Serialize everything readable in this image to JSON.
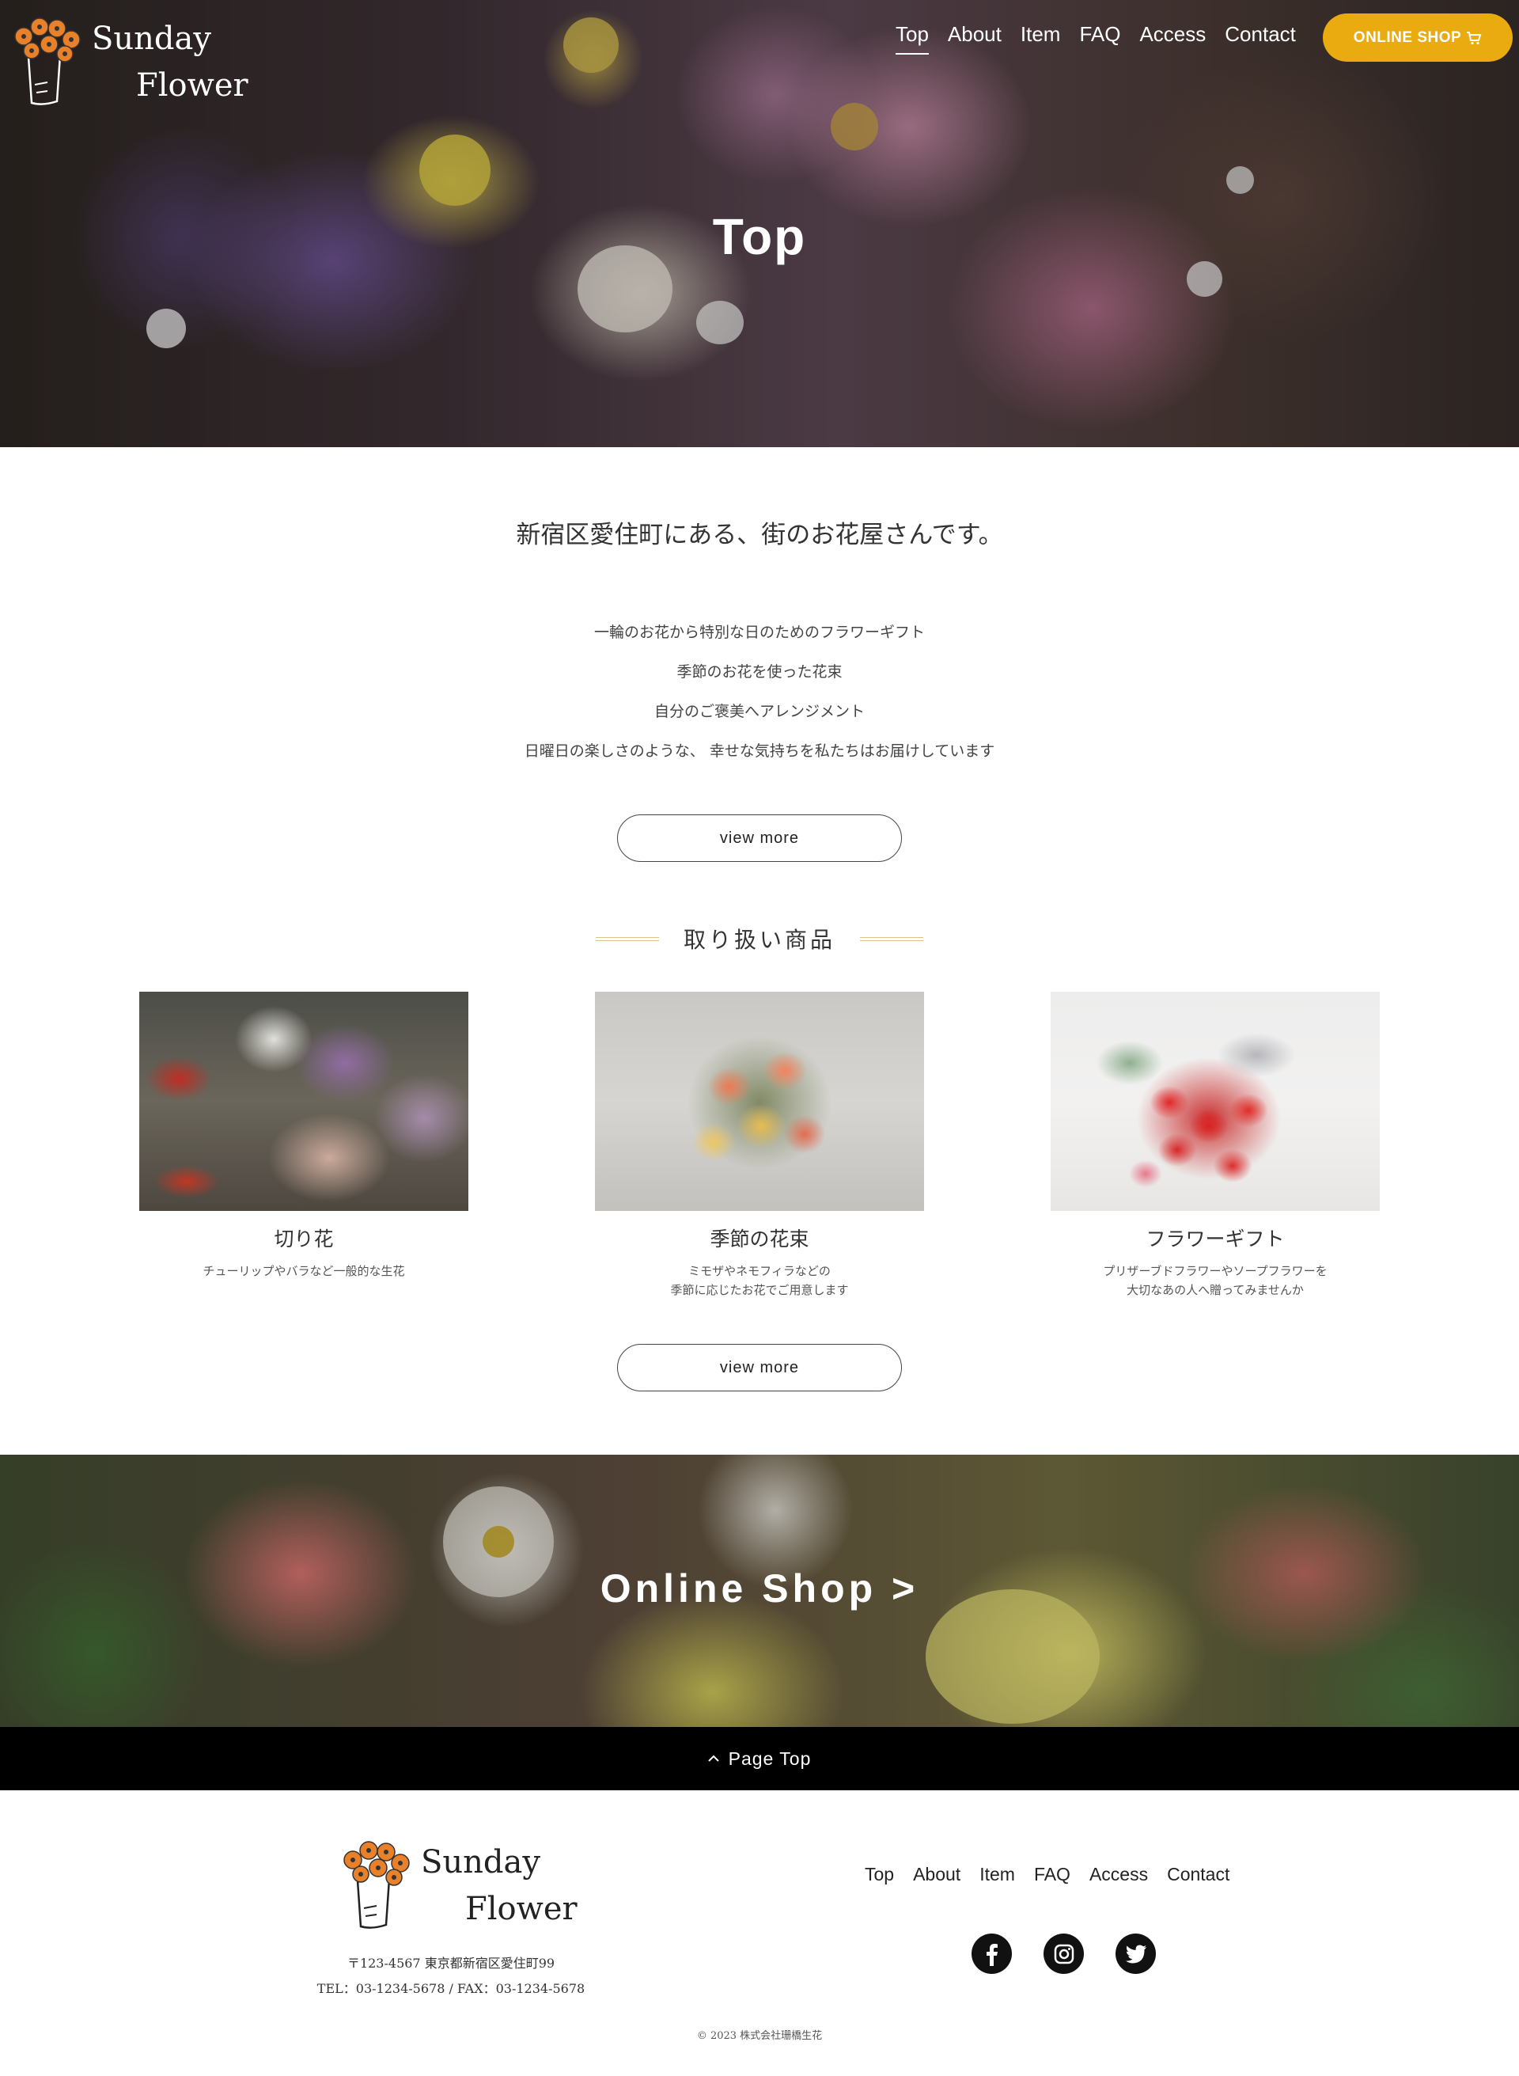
{
  "header": {
    "logo_line1": "Sunday",
    "logo_line2": "Flower",
    "nav": [
      "Top",
      "About",
      "Item",
      "FAQ",
      "Access",
      "Contact"
    ],
    "active_nav": "Top",
    "shop_button": "ONLINE SHOP",
    "shop_icon": "cart-icon",
    "accent_color": "#e9ab0f"
  },
  "hero": {
    "title": "Top"
  },
  "intro": {
    "lead": "新宿区愛住町にある、街のお花屋さんです。",
    "lines": [
      "一輪のお花から特別な日のためのフラワーギフト",
      "季節のお花を使った花束",
      "自分のご褒美へアレンジメント",
      "日曜日の楽しさのような、 幸せな気持ちを私たちはお届けしています"
    ],
    "view_more": "view more"
  },
  "products": {
    "heading": "取り扱い商品",
    "items": [
      {
        "name": "切り花",
        "sub": "チューリップやバラなど一般的な生花"
      },
      {
        "name": "季節の花束",
        "sub": "ミモザやネモフィラなどの\n季節に応じたお花でご用意します"
      },
      {
        "name": "フラワーギフト",
        "sub": "プリザーブドフラワーやソープフラワーを\n大切なあの人へ贈ってみませんか"
      }
    ],
    "view_more": "view more"
  },
  "banner": {
    "title": "Online Shop >"
  },
  "page_top": {
    "label": "Page Top",
    "icon": "chevron-up-icon"
  },
  "footer": {
    "logo_line1": "Sunday",
    "logo_line2": "Flower",
    "address": "〒123-4567 東京都新宿区愛住町99",
    "tel": "TEL：03-1234-5678 / FAX：03-1234-5678",
    "nav": [
      "Top",
      "About",
      "Item",
      "FAQ",
      "Access",
      "Contact"
    ],
    "social": [
      "facebook-icon",
      "instagram-icon",
      "twitter-icon"
    ],
    "copyright": "© 2023 株式会社珊橋生花"
  }
}
